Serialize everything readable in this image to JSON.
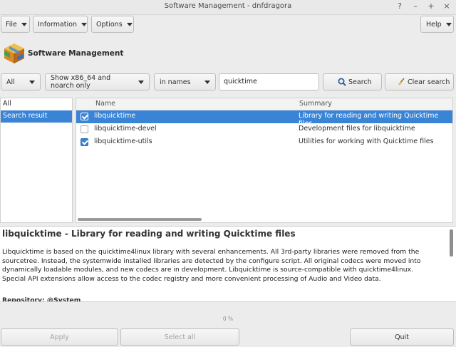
{
  "window": {
    "title": "Software Management - dnfdragora",
    "controls": [
      "?",
      "–",
      "+",
      "×"
    ]
  },
  "menu": {
    "file": "File",
    "information": "Information",
    "options": "Options",
    "help": "Help"
  },
  "brand": {
    "name": "Software Management",
    "icon": "package-box-icon"
  },
  "filters": {
    "group": "All",
    "arch": "Show x86_64 and noarch only",
    "search_field": "in names",
    "search_value": "quicktime",
    "search_button": "Search",
    "clear_button": "Clear search"
  },
  "groups": [
    {
      "label": "All",
      "selected": false
    },
    {
      "label": "Search result",
      "selected": true
    }
  ],
  "table": {
    "columns": {
      "name": "Name",
      "summary": "Summary"
    },
    "rows": [
      {
        "name": "libquicktime",
        "summary": "Library for reading and writing Quicktime files",
        "checked": true,
        "selected": true
      },
      {
        "name": "libquicktime-devel",
        "summary": "Development files for libquicktime",
        "checked": false,
        "selected": false
      },
      {
        "name": "libquicktime-utils",
        "summary": "Utilities for working with Quicktime files",
        "checked": true,
        "selected": false
      }
    ]
  },
  "description": {
    "heading": "libquicktime - Library for reading and writing Quicktime files",
    "body": "Libquicktime is based on the quicktime4linux library with several enhancements. All 3rd-party libraries were removed from the sourcetree. Instead, the systemwide installed libraries are detected by the configure script. All original codecs were moved into dynamically loadable modules, and new codecs are in development. Libquicktime is source-compatible with quicktime4linux. Special API extensions allow access to the codec registry and more convenient processing of Audio and Video data.",
    "repository": "Repository: @System"
  },
  "progress": "0 %",
  "bottom": {
    "apply": "Apply",
    "select_all": "Select all",
    "quit": "Quit"
  },
  "colors": {
    "selection": "#3a84d6",
    "background": "#ececec"
  }
}
